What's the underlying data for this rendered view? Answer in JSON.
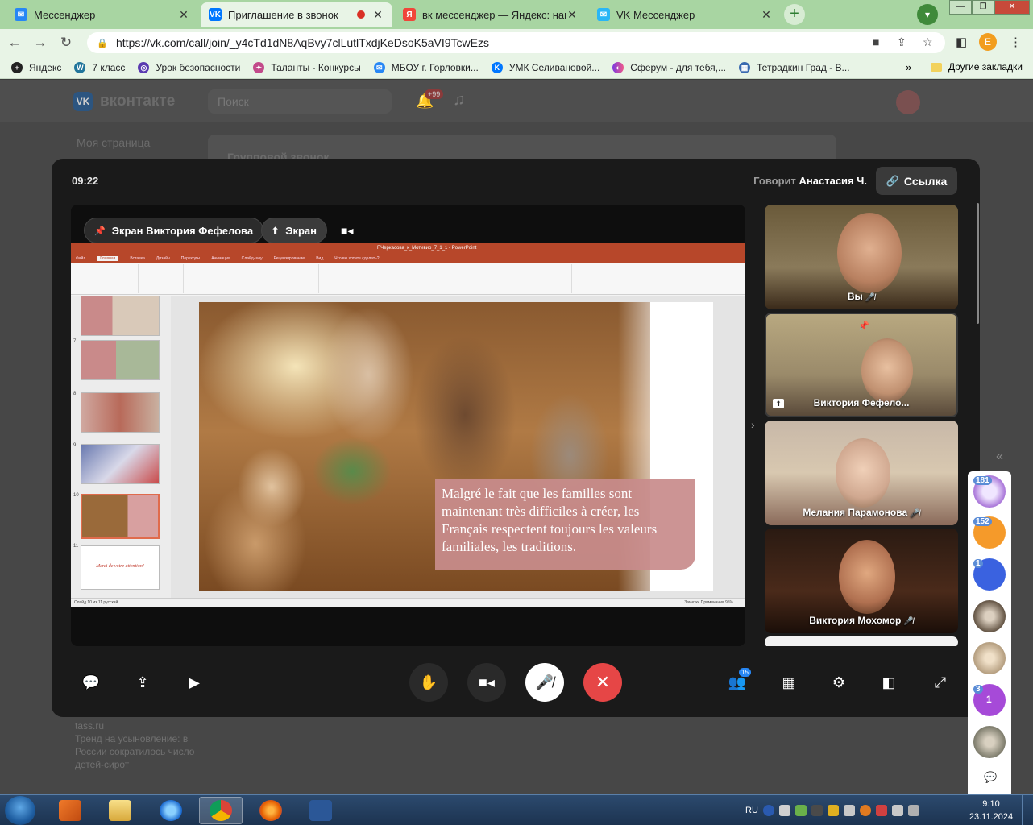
{
  "browser": {
    "tabs": [
      {
        "title": "Мессенджер",
        "favicon_color": "#2787f5"
      },
      {
        "title": "Приглашение в звонок",
        "favicon_color": "#0077ff",
        "recording": true
      },
      {
        "title": "вк мессенджер — Яндекс: нашё",
        "favicon_color": "#f0453a"
      },
      {
        "title": "VK Мессенджер",
        "favicon_color": "#29b6f6"
      }
    ],
    "url": "https://vk.com/call/join/_y4cTd1dN8AqBvy7clLutlTxdjKeDsoK5aVI9TcwEzs",
    "profile_letter": "E",
    "bookmarks": [
      "Яндекс",
      "7 класс",
      "Урок безопасности",
      "Таланты - Конкурсы",
      "МБОУ г. Горловки...",
      "УМК Селивановой...",
      "Сферум - для тебя,...",
      "Тетрадкин Град - В..."
    ],
    "bookmarks_more": "»",
    "other_bookmarks": "Другие закладки"
  },
  "vk": {
    "logo": "вконтакте",
    "search_placeholder": "Поиск",
    "notif_badge": "+99",
    "menu_my_page": "Моя страница",
    "card_title": "Групповой звонок",
    "news_source": "tass.ru",
    "news_text": "Тренд на усыновление: в России сократилось число детей-сирот"
  },
  "call": {
    "time": "09:22",
    "speaking_prefix": "Говорит",
    "speaking_name": "Анастасия Ч.",
    "link_label": "Ссылка",
    "screen_owner_label": "Экран Виктория Фефелова",
    "screen_label": "Экран",
    "participants_count": "15",
    "participants": [
      {
        "name": "Вы",
        "muted": true
      },
      {
        "name": "Виктория Фефело...",
        "pinned": true,
        "sharing": true
      },
      {
        "name": "Мелания Парамонова",
        "muted": true
      },
      {
        "name": "Виктория Мохомор",
        "muted": true
      }
    ]
  },
  "presentation": {
    "window_title": "Г.Черкасова_к_Мотивир_7_1_1 - PowerPoint",
    "ribbon_tabs": [
      "Файл",
      "Главная",
      "Вставка",
      "Дизайн",
      "Переходы",
      "Анимация",
      "Слайд-шоу",
      "Рецензирование",
      "Вид",
      "Что вы хотите сделать?"
    ],
    "status": "Слайд 10 из 11   русский",
    "status_right": "Заметки   Примечания   95%",
    "thumb_numbers": [
      "7",
      "8",
      "9",
      "10",
      "11"
    ],
    "slide_caption": "Malgré le fait que les familles sont maintenant très difficiles à créer, les Français respectent toujours les valeurs familiales, les traditions.",
    "last_thumb_text": "Merci de votre attention!"
  },
  "chats": [
    {
      "badge": "181",
      "color": "#a874d8"
    },
    {
      "badge": "152",
      "color": "#f59a2a"
    },
    {
      "badge": "1",
      "color": "#3a62e0"
    },
    {
      "badge": "",
      "color": "#8a7a6a"
    },
    {
      "badge": "",
      "color": "#c9b49a"
    },
    {
      "badge": "3",
      "color": "#a64ad8",
      "inner": "1"
    },
    {
      "badge": "",
      "color": "#7a7a6a"
    }
  ],
  "taskbar": {
    "lang": "RU",
    "time": "9:10",
    "date": "23.11.2024"
  }
}
